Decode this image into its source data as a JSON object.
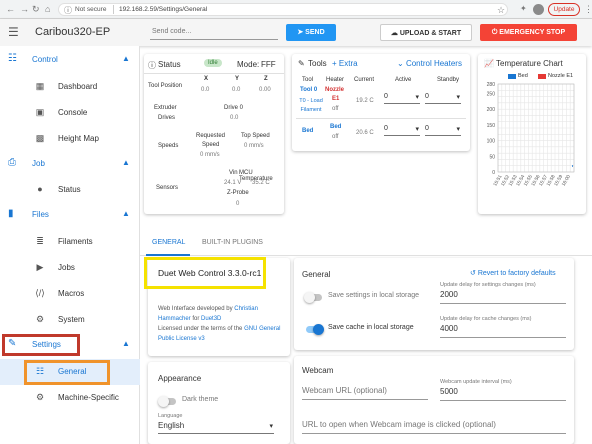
{
  "browser": {
    "back": "←",
    "forward": "→",
    "reload": "↻",
    "home": "⌂",
    "lock": "ⓘ",
    "not_secure": "Not secure",
    "url": "192.168.2.59/Settings/General",
    "update": "Update",
    "menu": "⋮",
    "star": "☆",
    "ext": "✦"
  },
  "appbar": {
    "menu_icon": "☰",
    "title": "Caribou320-EP",
    "send_placeholder": "Send code...",
    "send_label": "SEND",
    "upload_label": "UPLOAD & START",
    "estop_label": "EMERGENCY STOP"
  },
  "sidebar": {
    "control": {
      "label": "Control",
      "items": [
        "Dashboard",
        "Console",
        "Height Map"
      ]
    },
    "job": {
      "label": "Job",
      "items": [
        "Status"
      ]
    },
    "files": {
      "label": "Files",
      "items": [
        "Filaments",
        "Jobs",
        "Macros",
        "System"
      ]
    },
    "settings": {
      "label": "Settings",
      "items": [
        "General",
        "Machine-Specific"
      ]
    }
  },
  "status": {
    "title": "Status",
    "state": "Idle",
    "mode_label": "Mode:",
    "mode": "FFF",
    "toolpos_label": "Tool Position",
    "axes": [
      "X",
      "Y",
      "Z"
    ],
    "pos": [
      "0.0",
      "0.0",
      "0.00"
    ],
    "extruder_label": "Extruder",
    "drives_label": "Drives",
    "drive0_label": "Drive 0",
    "drive0": "0.0",
    "speeds_label": "Speeds",
    "req_label": "Requested",
    "speed_label": "Speed",
    "req_val": "0 mm/s",
    "top_label": "Top Speed",
    "top_val": "0 mm/s",
    "sensors_label": "Sensors",
    "vin_label": "Vin",
    "vin": "24.1 V",
    "mcu_label": "MCU Temperature",
    "mcu": "35.2 C",
    "zprobe_label": "Z-Probe",
    "zprobe": "0"
  },
  "tools": {
    "title": "Tools",
    "extra": "+ Extra",
    "heaters": "Control Heaters",
    "cols": [
      "Tool",
      "Heater",
      "Current",
      "Active",
      "Standby"
    ],
    "tool0": "Tool 0",
    "tool0_sub": "T0 - Load Filament",
    "nozzle": "Nozzle",
    "nozzle_e": "E1",
    "nozzle_state": "off",
    "nozzle_cur": "19.2 C",
    "active0": "0",
    "standby0": "0",
    "bed": "Bed",
    "bed_heater": "Bed",
    "bed_state": "off",
    "bed_cur": "20.6 C",
    "active1": "0",
    "standby1": "0"
  },
  "tempchart": {
    "title": "Temperature Chart",
    "legend": [
      {
        "name": "Bed",
        "color": "#1976d2"
      },
      {
        "name": "Nozzle E1",
        "color": "#e53935"
      }
    ],
    "ylabels": [
      "280",
      "250",
      "200",
      "150",
      "100",
      "50",
      "0"
    ],
    "xlabels": [
      "15:51",
      "15:52",
      "15:53",
      "15:54",
      "15:55",
      "15:56",
      "15:57",
      "15:58",
      "15:59",
      "16:00"
    ]
  },
  "tabs": [
    "GENERAL",
    "BUILT-IN PLUGINS"
  ],
  "about": {
    "title": "Duet Web Control 3.3.0-rc1",
    "line1": "Web Interface developed by ",
    "author": "Christian Hammacher",
    "line2": " for ",
    "duet3d": "Duet3D",
    "line3": "Licensed under the terms of the ",
    "gpl": "GNU General Public License v3"
  },
  "general": {
    "title": "General",
    "revert": "Revert to factory defaults",
    "save_storage": "Save settings in local storage",
    "delay_settings_label": "Update delay for settings changes (ms)",
    "delay_settings": "2000",
    "save_cache": "Save cache in local storage",
    "delay_cache_label": "Update delay for cache changes (ms)",
    "delay_cache": "4000"
  },
  "appearance": {
    "title": "Appearance",
    "dark": "Dark theme",
    "lang_label": "Language",
    "lang": "English"
  },
  "webcam": {
    "title": "Webcam",
    "url_placeholder": "Webcam URL (optional)",
    "interval_label": "Webcam update interval (ms)",
    "interval": "5000",
    "click_placeholder": "URL to open when Webcam image is clicked (optional)"
  },
  "colors": {
    "accent": "#1976d2",
    "estop": "#f44336",
    "highlight_red": "#c0392b",
    "highlight_orange": "#f0932b",
    "highlight_yellow": "#f5e200"
  }
}
